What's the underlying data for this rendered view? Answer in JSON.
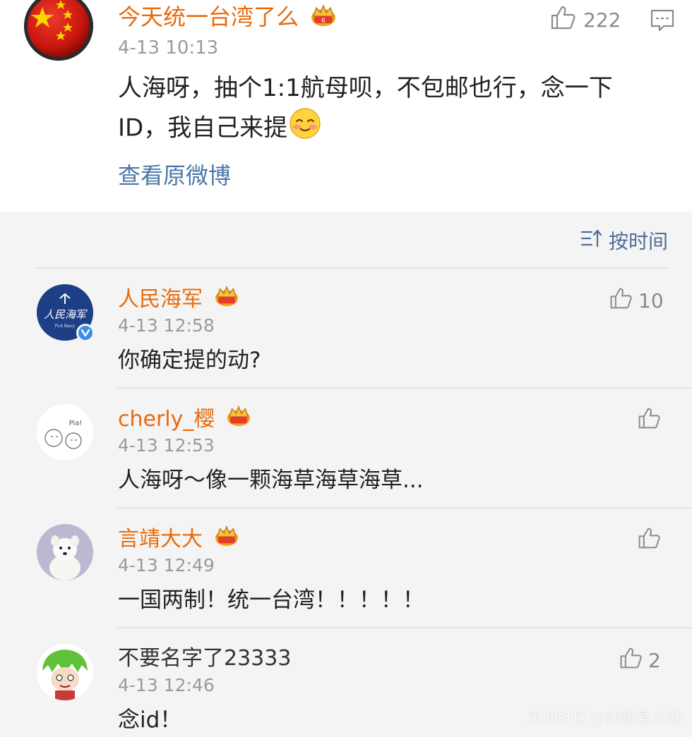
{
  "post": {
    "username": "今天统一台湾了么",
    "time": "4-13 10:13",
    "likes": "222",
    "text": "人海呀，抽个1:1航母呗，不包邮也行，念一下ID，我自己来提",
    "view_original": "查看原微博"
  },
  "sort": {
    "label": "按时间"
  },
  "comments": [
    {
      "username": "人民海军",
      "time": "4-13 12:58",
      "text": "你确定提的动?",
      "likes": "10",
      "avatar_text": "人民海军",
      "avatar_sub": "PLA Navy"
    },
    {
      "username": "cherly_樱",
      "time": "4-13 12:53",
      "text": "人海呀～像一颗海草海草海草...",
      "likes": "",
      "avatar_text": "Pia!"
    },
    {
      "username": "言靖大大",
      "time": "4-13 12:49",
      "text": "一国两制！统一台湾！！！！！",
      "likes": ""
    },
    {
      "username": "不要名字了23333",
      "time": "4-13 12:46",
      "text": "念id！",
      "likes": "2"
    }
  ],
  "watermark": "风闻社区@剑啸易水寒",
  "colors": {
    "vip_name": "#e86b0c",
    "link": "#4a77a8",
    "sort": "#4d6f98",
    "background": "#f4f4f4"
  }
}
